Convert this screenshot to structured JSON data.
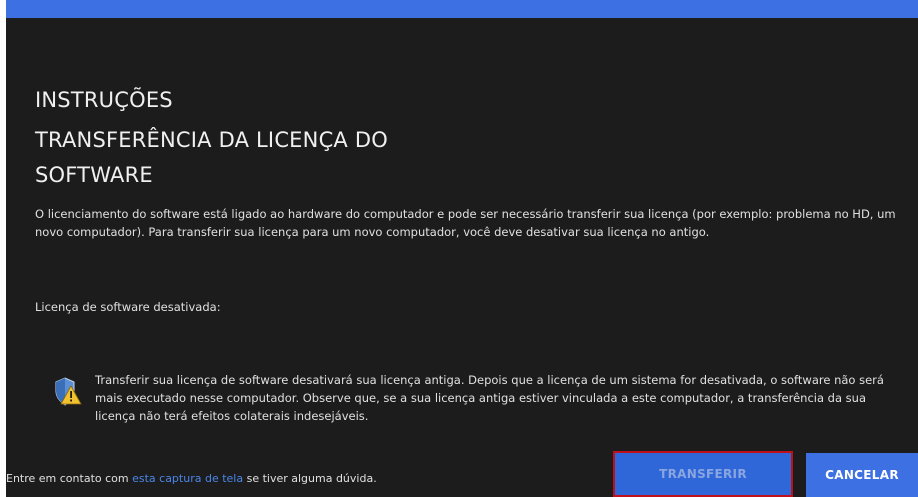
{
  "title_line1": "INSTRUÇÕES",
  "title_line2": "TRANSFERÊNCIA DA LICENÇA DO",
  "title_line3": "SOFTWARE",
  "description": "O licenciamento do software está ligado ao hardware do computador e pode ser necessário transferir sua licença (por exemplo: problema no HD, um novo computador). Para transferir sua licença para um novo computador, você deve desativar sua licença no antigo.",
  "deactivated_label": "Licença de software desativada:",
  "warning_text": "Transferir sua licença de software desativará sua licença antiga. Depois que a licença de um sistema for desativada, o software não será mais executado nesse computador. Observe que, se a sua licença antiga estiver vinculada a este computador, a transferência da sua licença não terá efeitos colaterais indesejáveis.",
  "footer": {
    "prefix": "Entre em contato com ",
    "link": "esta captura de tela",
    "suffix": " se tiver alguma dúvida."
  },
  "buttons": {
    "transfer": "TRANSFERIR",
    "cancel": "CANCELAR"
  },
  "colors": {
    "accent": "#3d70e3",
    "background": "#1c1c1c",
    "highlight_border": "#c0101c",
    "link": "#4a86e8"
  },
  "icons": {
    "warning": "shield-warning-icon"
  }
}
